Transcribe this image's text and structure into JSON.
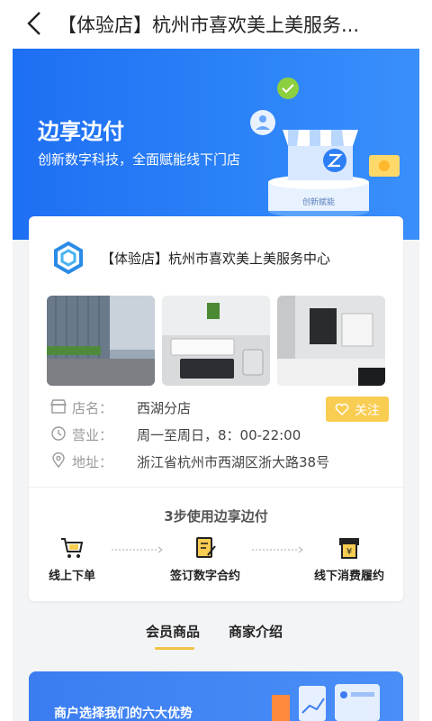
{
  "header": {
    "title": "【体验店】杭州市喜欢美上美服务..."
  },
  "banner": {
    "title": "边享边付",
    "subtitle": "创新数字科技，全面赋能线下门店",
    "stage_label": "创新赋能"
  },
  "store": {
    "name": "【体验店】杭州市喜欢美上美服务中心",
    "info": [
      {
        "label": "店名：",
        "value": "西湖分店",
        "icon": "store-icon"
      },
      {
        "label": "营业：",
        "value": "周一至周日，8：00-22:00",
        "icon": "clock-icon"
      },
      {
        "label": "地址：",
        "value": "浙江省杭州市西湖区浙大路38号",
        "icon": "location-icon"
      }
    ],
    "follow_label": "关注"
  },
  "steps": {
    "title": "3步使用边享边付",
    "items": [
      {
        "label": "线上下单",
        "icon": "cart-icon"
      },
      {
        "label": "签订数字合约",
        "icon": "contract-icon"
      },
      {
        "label": "线下消费履约",
        "icon": "voucher-icon"
      }
    ]
  },
  "tabs": [
    {
      "label": "会员商品",
      "active": true
    },
    {
      "label": "商家介绍",
      "active": false
    }
  ],
  "advantages": {
    "title": "商户选择我们的六大优势"
  },
  "colors": {
    "brand_blue": "#1e6ff3",
    "accent_yellow": "#f9cc52"
  }
}
